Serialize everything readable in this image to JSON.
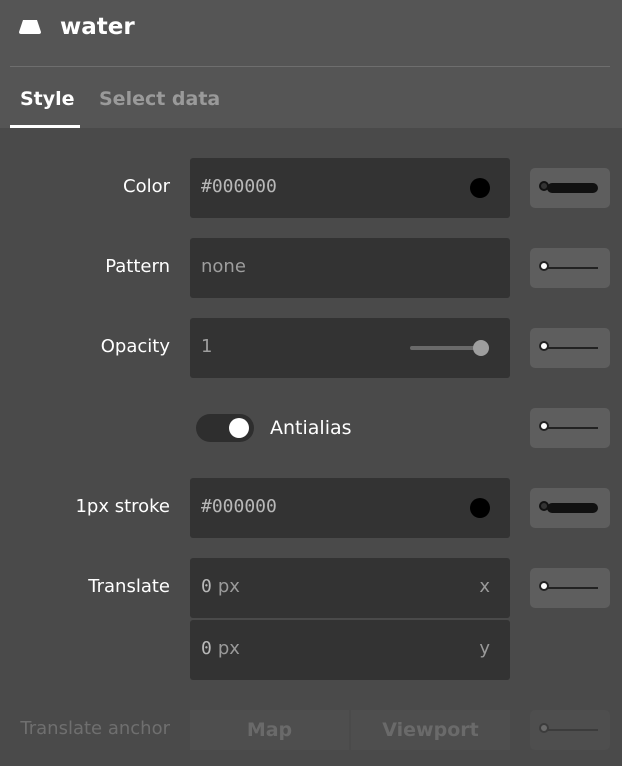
{
  "header": {
    "title": "water",
    "layer_icon": "fill-layer-icon"
  },
  "tabs": [
    {
      "label": "Style"
    },
    {
      "label": "Select data"
    }
  ],
  "fields": {
    "color": {
      "label": "Color",
      "value": "#000000",
      "swatch_color": "#000000"
    },
    "pattern": {
      "label": "Pattern",
      "value": "none"
    },
    "opacity": {
      "label": "Opacity",
      "value": "1",
      "slider_level": 1.0
    },
    "antialias": {
      "label": "Antialias",
      "checked": true
    },
    "stroke": {
      "label": "1px stroke",
      "value": "#000000",
      "swatch_color": "#000000"
    },
    "translate": {
      "label": "Translate",
      "x": {
        "value": "0",
        "unit": "px",
        "axis": "x"
      },
      "y": {
        "value": "0",
        "unit": "px",
        "axis": "y"
      }
    },
    "translate_anchor": {
      "label": "Translate anchor",
      "options": [
        "Map",
        "Viewport"
      ],
      "disabled": true
    }
  },
  "icons": {
    "zoom_function": "zoom-function-icon"
  }
}
